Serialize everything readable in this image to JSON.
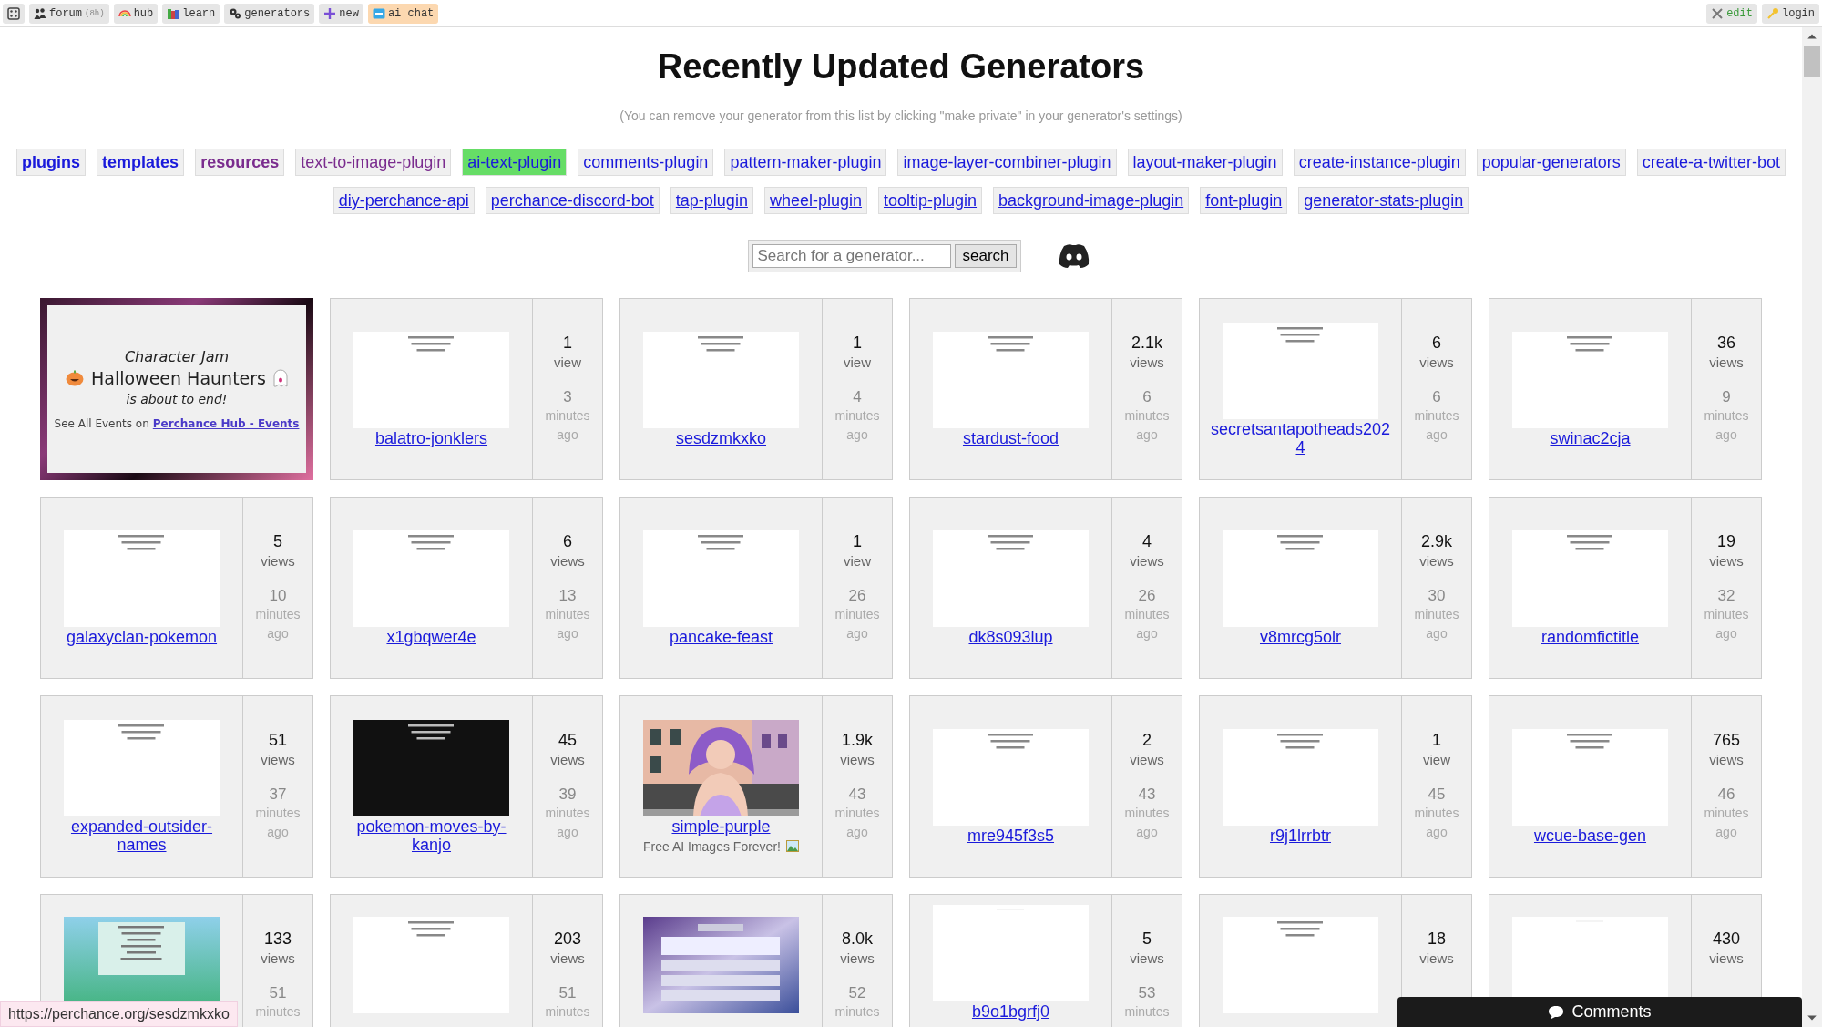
{
  "top_bar": {
    "left": [
      {
        "highlighted": false
      },
      {
        "label": "forum",
        "note": "(8h)",
        "highlighted": false
      },
      {
        "label": "hub",
        "highlighted": false
      },
      {
        "label": "learn",
        "highlighted": false
      },
      {
        "label": "generators",
        "highlighted": false
      },
      {
        "label": "new",
        "highlighted": false
      },
      {
        "label": "ai chat",
        "highlighted": true
      }
    ],
    "right": [
      {
        "label": "edit"
      },
      {
        "label": "login"
      }
    ]
  },
  "title": "Recently Updated Generators",
  "subtitle": "(You can remove your generator from this list by clicking \"make private\" in your generator's settings)",
  "links": [
    [
      {
        "label": "plugins",
        "bold": true,
        "visited": false,
        "highlighted": false
      },
      {
        "label": "templates",
        "bold": true,
        "visited": false,
        "highlighted": false
      },
      {
        "label": "resources",
        "bold": true,
        "visited": true,
        "highlighted": false
      },
      {
        "label": "text-to-image-plugin",
        "bold": false,
        "visited": true,
        "highlighted": false
      },
      {
        "label": "ai-text-plugin",
        "bold": false,
        "visited": false,
        "highlighted": true
      },
      {
        "label": "comments-plugin",
        "bold": false,
        "visited": false,
        "highlighted": false
      },
      {
        "label": "pattern-maker-plugin",
        "bold": false,
        "visited": false,
        "highlighted": false
      },
      {
        "label": "image-layer-combiner-plugin",
        "bold": false,
        "visited": false,
        "highlighted": false
      },
      {
        "label": "layout-maker-plugin",
        "bold": false,
        "visited": false,
        "highlighted": false
      },
      {
        "label": "create-instance-plugin",
        "bold": false,
        "visited": false,
        "highlighted": false
      },
      {
        "label": "popular-generators",
        "bold": false,
        "visited": false,
        "highlighted": false
      },
      {
        "label": "create-a-twitter-bot",
        "bold": false,
        "visited": false,
        "highlighted": false
      }
    ],
    [
      {
        "label": "diy-perchance-api",
        "bold": false,
        "visited": false,
        "highlighted": false
      },
      {
        "label": "perchance-discord-bot",
        "bold": false,
        "visited": false,
        "highlighted": false
      },
      {
        "label": "tap-plugin",
        "bold": false,
        "visited": false,
        "highlighted": false
      },
      {
        "label": "wheel-plugin",
        "bold": false,
        "visited": false,
        "highlighted": false
      },
      {
        "label": "tooltip-plugin",
        "bold": false,
        "visited": false,
        "highlighted": false
      },
      {
        "label": "background-image-plugin",
        "bold": false,
        "visited": false,
        "highlighted": false
      },
      {
        "label": "font-plugin",
        "bold": false,
        "visited": false,
        "highlighted": false
      },
      {
        "label": "generator-stats-plugin",
        "bold": false,
        "visited": false,
        "highlighted": false
      }
    ]
  ],
  "search": {
    "placeholder": "Search for a generator...",
    "button": "search"
  },
  "cards": [
    {
      "kind": "event",
      "kicker": "Character Jam",
      "name": "Halloween Haunters",
      "note": "is about to end!",
      "lead": "See All Events on",
      "link": "Perchance Hub - Events"
    },
    {
      "kind": "generator",
      "name": "balatro-jonklers",
      "views": "1",
      "views_unit": "view",
      "age": "3",
      "age_unit": "minutes",
      "age_suffix": "ago"
    },
    {
      "kind": "generator",
      "name": "sesdzmkxko",
      "views": "1",
      "views_unit": "view",
      "age": "4",
      "age_unit": "minutes",
      "age_suffix": "ago"
    },
    {
      "kind": "generator",
      "name": "stardust-food",
      "views": "2.1k",
      "views_unit": "views",
      "age": "6",
      "age_unit": "minutes",
      "age_suffix": "ago"
    },
    {
      "kind": "generator",
      "name": "secretsantapotheads2024",
      "views": "6",
      "views_unit": "views",
      "age": "6",
      "age_unit": "minutes",
      "age_suffix": "ago"
    },
    {
      "kind": "generator",
      "name": "swinac2cja",
      "views": "36",
      "views_unit": "views",
      "age": "9",
      "age_unit": "minutes",
      "age_suffix": "ago"
    },
    {
      "kind": "generator",
      "name": "galaxyclan-pokemon",
      "views": "5",
      "views_unit": "views",
      "age": "10",
      "age_unit": "minutes",
      "age_suffix": "ago"
    },
    {
      "kind": "generator",
      "name": "x1gbqwer4e",
      "views": "6",
      "views_unit": "views",
      "age": "13",
      "age_unit": "minutes",
      "age_suffix": "ago"
    },
    {
      "kind": "generator",
      "name": "pancake-feast",
      "views": "1",
      "views_unit": "view",
      "age": "26",
      "age_unit": "minutes",
      "age_suffix": "ago"
    },
    {
      "kind": "generator",
      "name": "dk8s093lup",
      "views": "4",
      "views_unit": "views",
      "age": "26",
      "age_unit": "minutes",
      "age_suffix": "ago"
    },
    {
      "kind": "generator",
      "name": "v8mrcg5olr",
      "views": "2.9k",
      "views_unit": "views",
      "age": "30",
      "age_unit": "minutes",
      "age_suffix": "ago"
    },
    {
      "kind": "generator",
      "name": "randomfictitle",
      "views": "19",
      "views_unit": "views",
      "age": "32",
      "age_unit": "minutes",
      "age_suffix": "ago"
    },
    {
      "kind": "generator",
      "name": "expanded-outsider-names",
      "views": "51",
      "views_unit": "views",
      "age": "37",
      "age_unit": "minutes",
      "age_suffix": "ago"
    },
    {
      "kind": "generator",
      "name": "pokemon-moves-by-kanjo",
      "views": "45",
      "views_unit": "views",
      "age": "39",
      "age_unit": "minutes",
      "age_suffix": "ago"
    },
    {
      "kind": "generator",
      "name": "simple-purple",
      "description": "Free AI Images Forever!",
      "views": "1.9k",
      "views_unit": "views",
      "age": "43",
      "age_unit": "minutes",
      "age_suffix": "ago"
    },
    {
      "kind": "generator",
      "name": "mre945f3s5",
      "views": "2",
      "views_unit": "views",
      "age": "43",
      "age_unit": "minutes",
      "age_suffix": "ago"
    },
    {
      "kind": "generator",
      "name": "r9j1lrrbtr",
      "views": "1",
      "views_unit": "view",
      "age": "45",
      "age_unit": "minutes",
      "age_suffix": "ago"
    },
    {
      "kind": "generator",
      "name": "wcue-base-gen",
      "views": "765",
      "views_unit": "views",
      "age": "46",
      "age_unit": "minutes",
      "age_suffix": "ago"
    },
    {
      "kind": "generator",
      "views": "133",
      "views_unit": "views",
      "age": "51",
      "age_unit": "minutes"
    },
    {
      "kind": "generator",
      "views": "203",
      "views_unit": "views",
      "age": "51",
      "age_unit": "minutes"
    },
    {
      "kind": "generator",
      "views": "8.0k",
      "views_unit": "views",
      "age": "52",
      "age_unit": "minutes"
    },
    {
      "kind": "generator",
      "name": "b9o1bgrfj0",
      "views": "5",
      "views_unit": "views",
      "age": "53",
      "age_unit": "minutes"
    },
    {
      "kind": "generator",
      "views": "18",
      "views_unit": "views"
    },
    {
      "kind": "generator",
      "views": "430",
      "views_unit": "views"
    }
  ],
  "status_url": "https://perchance.org/sesdzmkxko",
  "comments_bar": {
    "label": "Comments"
  }
}
